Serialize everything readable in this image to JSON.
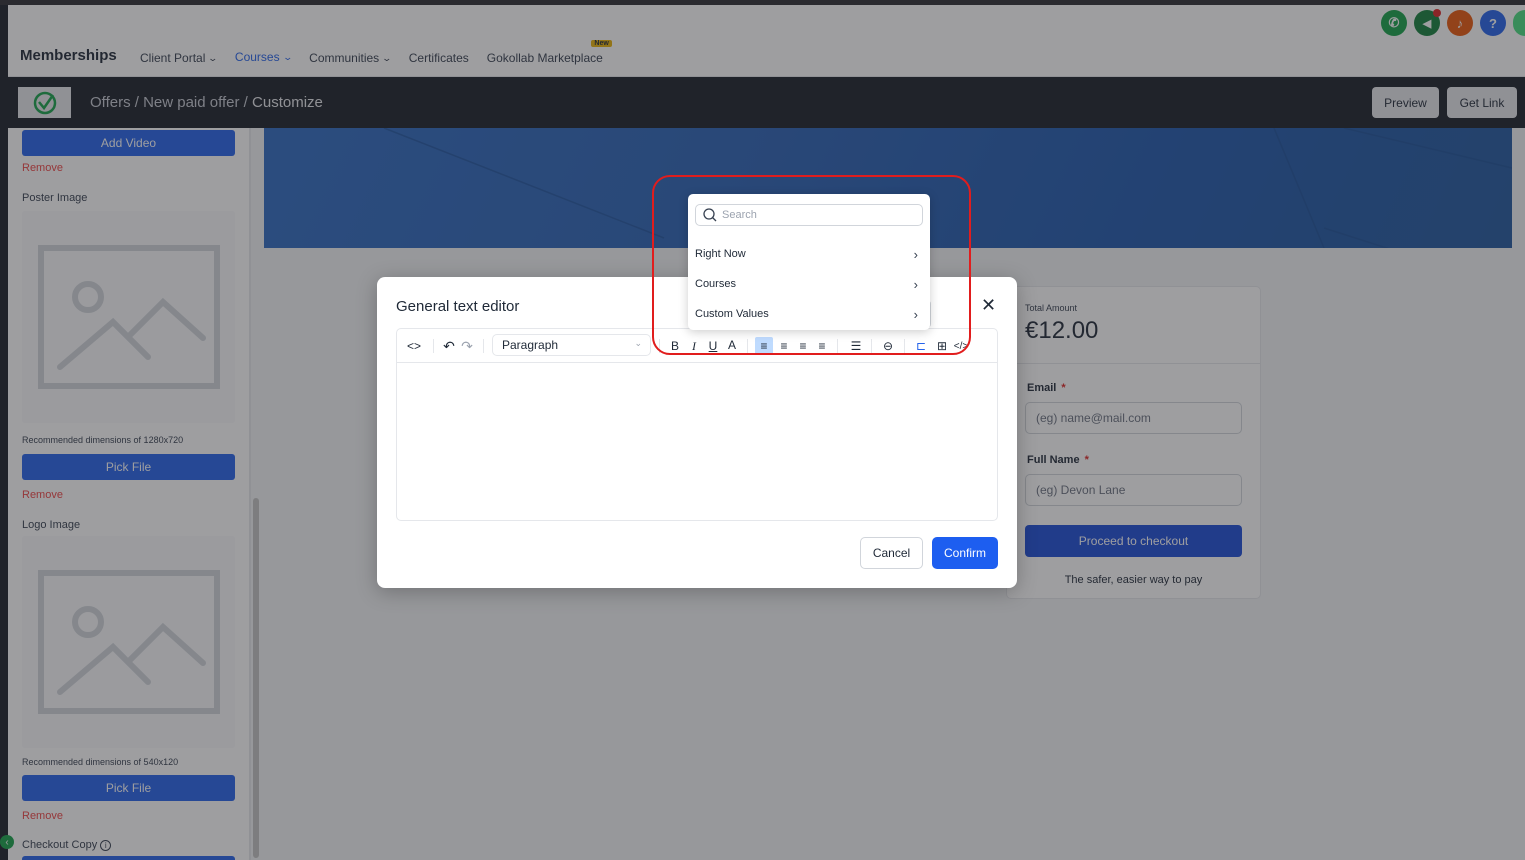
{
  "topnav": {
    "brand": "Memberships",
    "items": [
      {
        "label": "Client Portal",
        "dropdown": true
      },
      {
        "label": "Courses",
        "dropdown": true,
        "active": true
      },
      {
        "label": "Communities",
        "dropdown": true
      },
      {
        "label": "Certificates"
      },
      {
        "label": "Gokollab Marketplace",
        "badge": "New"
      }
    ],
    "icons": [
      {
        "name": "phone-icon",
        "glyph": "✆",
        "color": "#16a34a"
      },
      {
        "name": "megaphone-icon",
        "glyph": "📢",
        "color": "#15803d",
        "notification": true
      },
      {
        "name": "bell-icon",
        "glyph": "🔔",
        "color": "#ea580c"
      },
      {
        "name": "help-icon",
        "glyph": "?",
        "color": "#2563eb"
      }
    ]
  },
  "subheader": {
    "breadcrumb": [
      "Offers",
      "New paid offer",
      "Customize"
    ],
    "crumb_sep": " / ",
    "crumb_1": "Offers / New paid offer / ",
    "crumb_last": "Customize",
    "preview_label": "Preview",
    "getlink_label": "Get Link"
  },
  "sidebar": {
    "add_video": "Add Video",
    "remove": "Remove",
    "poster_label": "Poster Image",
    "poster_note": "Recommended dimensions of 1280x720",
    "pick_file": "Pick File",
    "logo_label": "Logo Image",
    "logo_note": "Recommended dimensions of 540x120",
    "checkout_copy": "Checkout Copy"
  },
  "checkout": {
    "total_label": "Total Amount",
    "amount": "€12.00",
    "email_label": "Email",
    "email_placeholder": "(eg) name@mail.com",
    "name_label": "Full Name",
    "name_placeholder": "(eg) Devon Lane",
    "required_mark": "*",
    "proceed": "Proceed to checkout",
    "tagline": "The safer, easier way to pay"
  },
  "modal": {
    "title": "General text editor",
    "close": "✕",
    "block_format": "Paragraph",
    "cancel": "Cancel",
    "confirm": "Confirm",
    "toolbar": {
      "code": "<>",
      "undo": "↶",
      "redo": "↷",
      "bold": "B",
      "italic": "I",
      "underline": "U",
      "text_color": "A",
      "align_left": "≡",
      "align_center": "≡",
      "align_right": "≡",
      "align_justify": "≡",
      "list": "☰",
      "link": "⊖",
      "custom_values": "⊏",
      "table": "⊞",
      "source": "</>"
    }
  },
  "dropdown": {
    "search_placeholder": "Search",
    "items": [
      "Right Now",
      "Courses",
      "Custom Values"
    ],
    "chevron": "›"
  }
}
